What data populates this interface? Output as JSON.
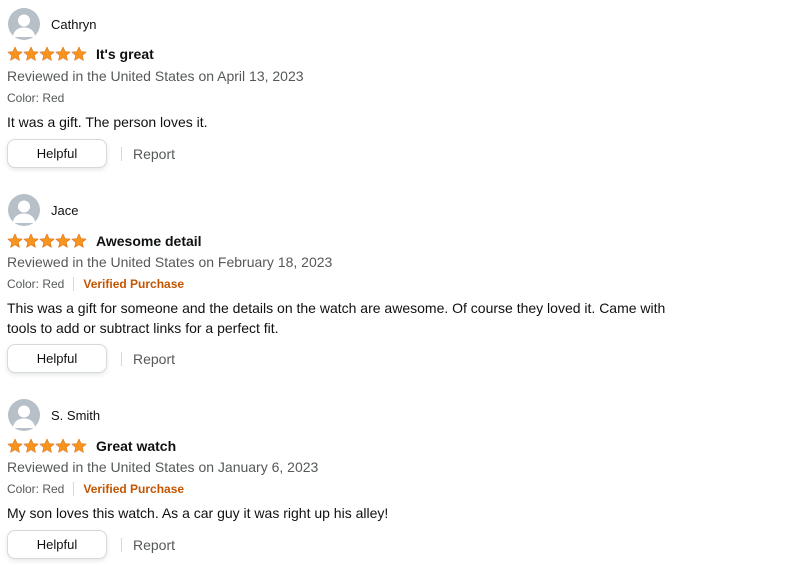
{
  "colors": {
    "star": "#f7941d",
    "verified": "#c45500",
    "secondary_text": "#565959",
    "avatar_bg": "#b7c0c8"
  },
  "icons": {
    "avatar": "person-silhouette-icon",
    "star": "filled-star-icon"
  },
  "reviews": [
    {
      "profile_name": "Cathryn",
      "rating": 5,
      "title": "It's great",
      "date": "Reviewed in the United States on April 13, 2023",
      "color": "Color: Red",
      "verified": "",
      "body": "It was a gift. The person loves it.",
      "helpful_label": "Helpful",
      "report_label": "Report"
    },
    {
      "profile_name": "Jace",
      "rating": 5,
      "title": "Awesome detail",
      "date": "Reviewed in the United States on February 18, 2023",
      "color": "Color: Red",
      "verified": "Verified Purchase",
      "body": "This was a gift for someone and the details on the watch are awesome. Of course they loved it. Came with tools to add or subtract links for a perfect fit.",
      "helpful_label": "Helpful",
      "report_label": "Report"
    },
    {
      "profile_name": "S. Smith",
      "rating": 5,
      "title": "Great watch",
      "date": "Reviewed in the United States on January 6, 2023",
      "color": "Color: Red",
      "verified": "Verified Purchase",
      "body": "My son loves this watch. As a car guy it was right up his alley!",
      "helpful_label": "Helpful",
      "report_label": "Report"
    }
  ]
}
